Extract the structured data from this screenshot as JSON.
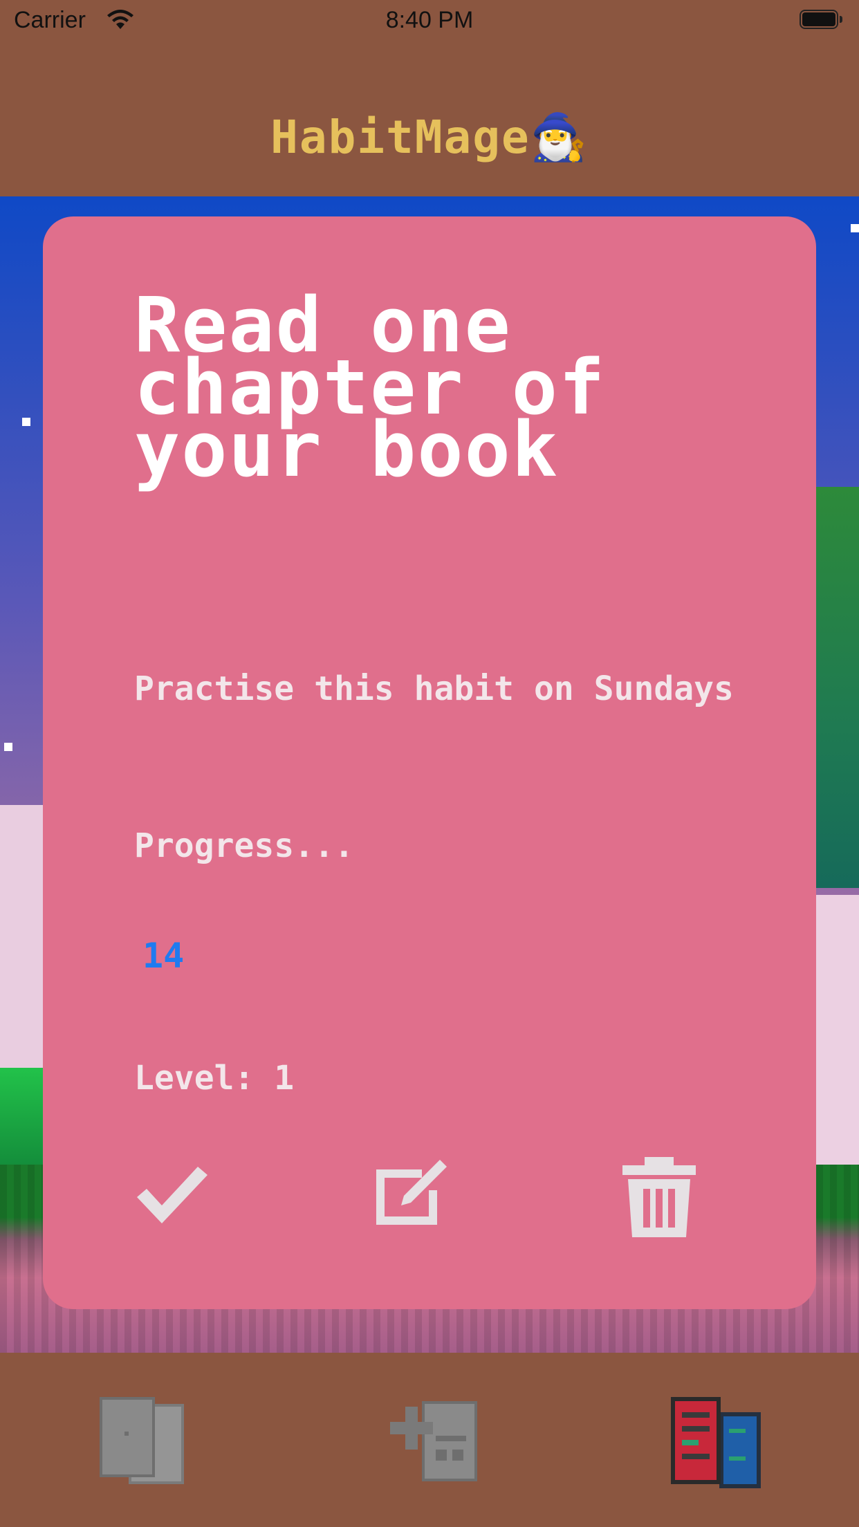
{
  "status_bar": {
    "carrier": "Carrier",
    "time": "8:40 PM"
  },
  "header": {
    "title": "HabitMage",
    "title_emoji": "🧙‍♂️",
    "title_color": "#e6c05c"
  },
  "habit_card": {
    "title": "Read one chapter of your book",
    "schedule": "Practise this habit on Sundays",
    "progress_label": "Progress...",
    "progress_count": "14",
    "level_label": "Level: 1",
    "background_color": "#e06f8c",
    "actions": [
      {
        "name": "complete",
        "icon": "checkmark-icon"
      },
      {
        "name": "edit",
        "icon": "edit-icon"
      },
      {
        "name": "delete",
        "icon": "trash-icon"
      }
    ]
  },
  "tab_bar": {
    "tabs": [
      {
        "name": "habits",
        "icon": "cards-icon",
        "active": false
      },
      {
        "name": "add-habit",
        "icon": "add-document-icon",
        "active": false
      },
      {
        "name": "library",
        "icon": "books-icon",
        "active": true
      }
    ]
  }
}
